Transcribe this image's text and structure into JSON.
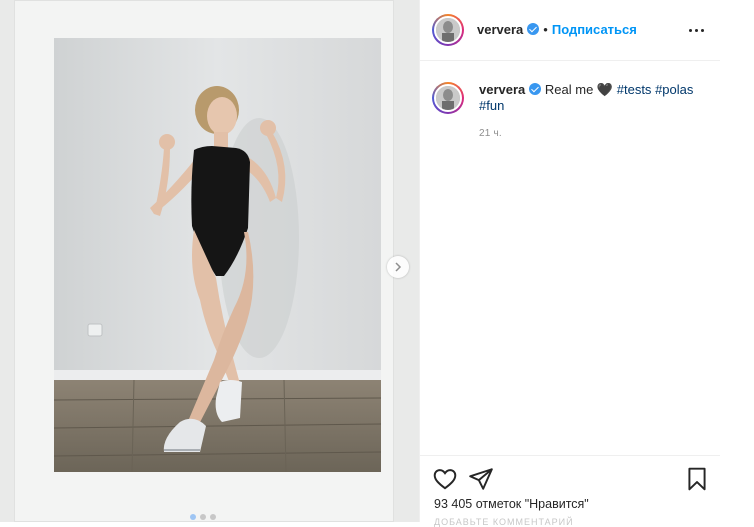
{
  "author": {
    "username": "ververa",
    "follow_label": "Подписаться",
    "separator": "•"
  },
  "caption": {
    "username": "ververa",
    "text": "Real me 🖤",
    "tags": [
      "#tests",
      "#polas",
      "#fun"
    ],
    "time": "21 ч."
  },
  "actions": {
    "likes_text": "93 405 отметок \"Нравится\"",
    "cut_text": "ДОБАВЬТЕ КОММЕНТАРИЙ"
  },
  "icons": {
    "like": "heart-icon",
    "share": "paper-plane-icon",
    "save": "bookmark-icon",
    "more": "more-dots-icon",
    "next": "chevron-right-icon",
    "verified": "verified-badge-icon"
  },
  "colors": {
    "link_blue": "#0095f6",
    "hashtag": "#00376b",
    "verified": "#3897f0",
    "muted": "#8e8e8e"
  }
}
